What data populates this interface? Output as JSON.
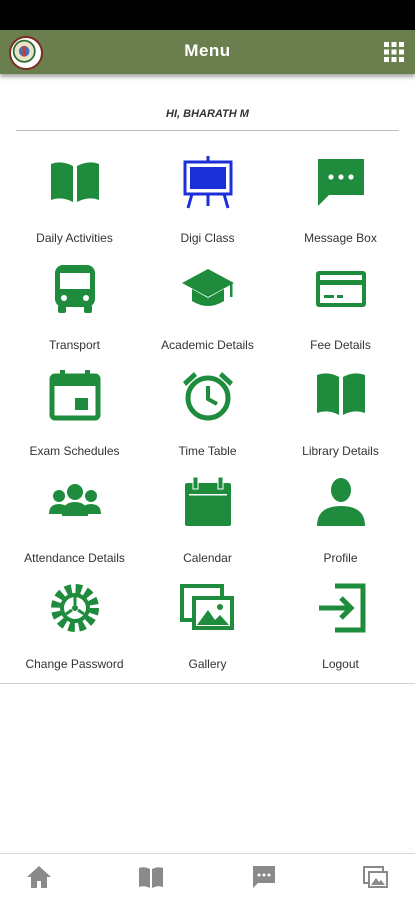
{
  "app_bar": {
    "title": "Menu"
  },
  "greeting": "HI, BHARATH M",
  "colors": {
    "app_bar": "#6b7f4e",
    "icon_green": "#1e8c3c",
    "icon_blue": "#1a2fd8",
    "nav_gray": "#8a8a8a"
  },
  "menu": [
    {
      "label": "Daily Activities",
      "icon": "open-book-icon"
    },
    {
      "label": "Digi Class",
      "icon": "digi-board-icon"
    },
    {
      "label": "Message Box",
      "icon": "chat-bubble-icon"
    },
    {
      "label": "Transport",
      "icon": "bus-icon"
    },
    {
      "label": "Academic Details",
      "icon": "graduation-cap-icon"
    },
    {
      "label": "Fee Details",
      "icon": "credit-card-icon"
    },
    {
      "label": "Exam Schedules",
      "icon": "calendar-event-icon"
    },
    {
      "label": "Time Table",
      "icon": "alarm-clock-icon"
    },
    {
      "label": "Library Details",
      "icon": "book-icon"
    },
    {
      "label": "Attendance Details",
      "icon": "group-people-icon"
    },
    {
      "label": "Calendar",
      "icon": "calendar-icon"
    },
    {
      "label": "Profile",
      "icon": "person-icon"
    },
    {
      "label": "Change Password",
      "icon": "gear-icon"
    },
    {
      "label": "Gallery",
      "icon": "photo-gallery-icon"
    },
    {
      "label": "Logout",
      "icon": "logout-icon"
    }
  ],
  "bottom_nav": [
    {
      "icon": "home-icon"
    },
    {
      "icon": "book-icon"
    },
    {
      "icon": "chat-icon"
    },
    {
      "icon": "gallery-icon"
    }
  ]
}
